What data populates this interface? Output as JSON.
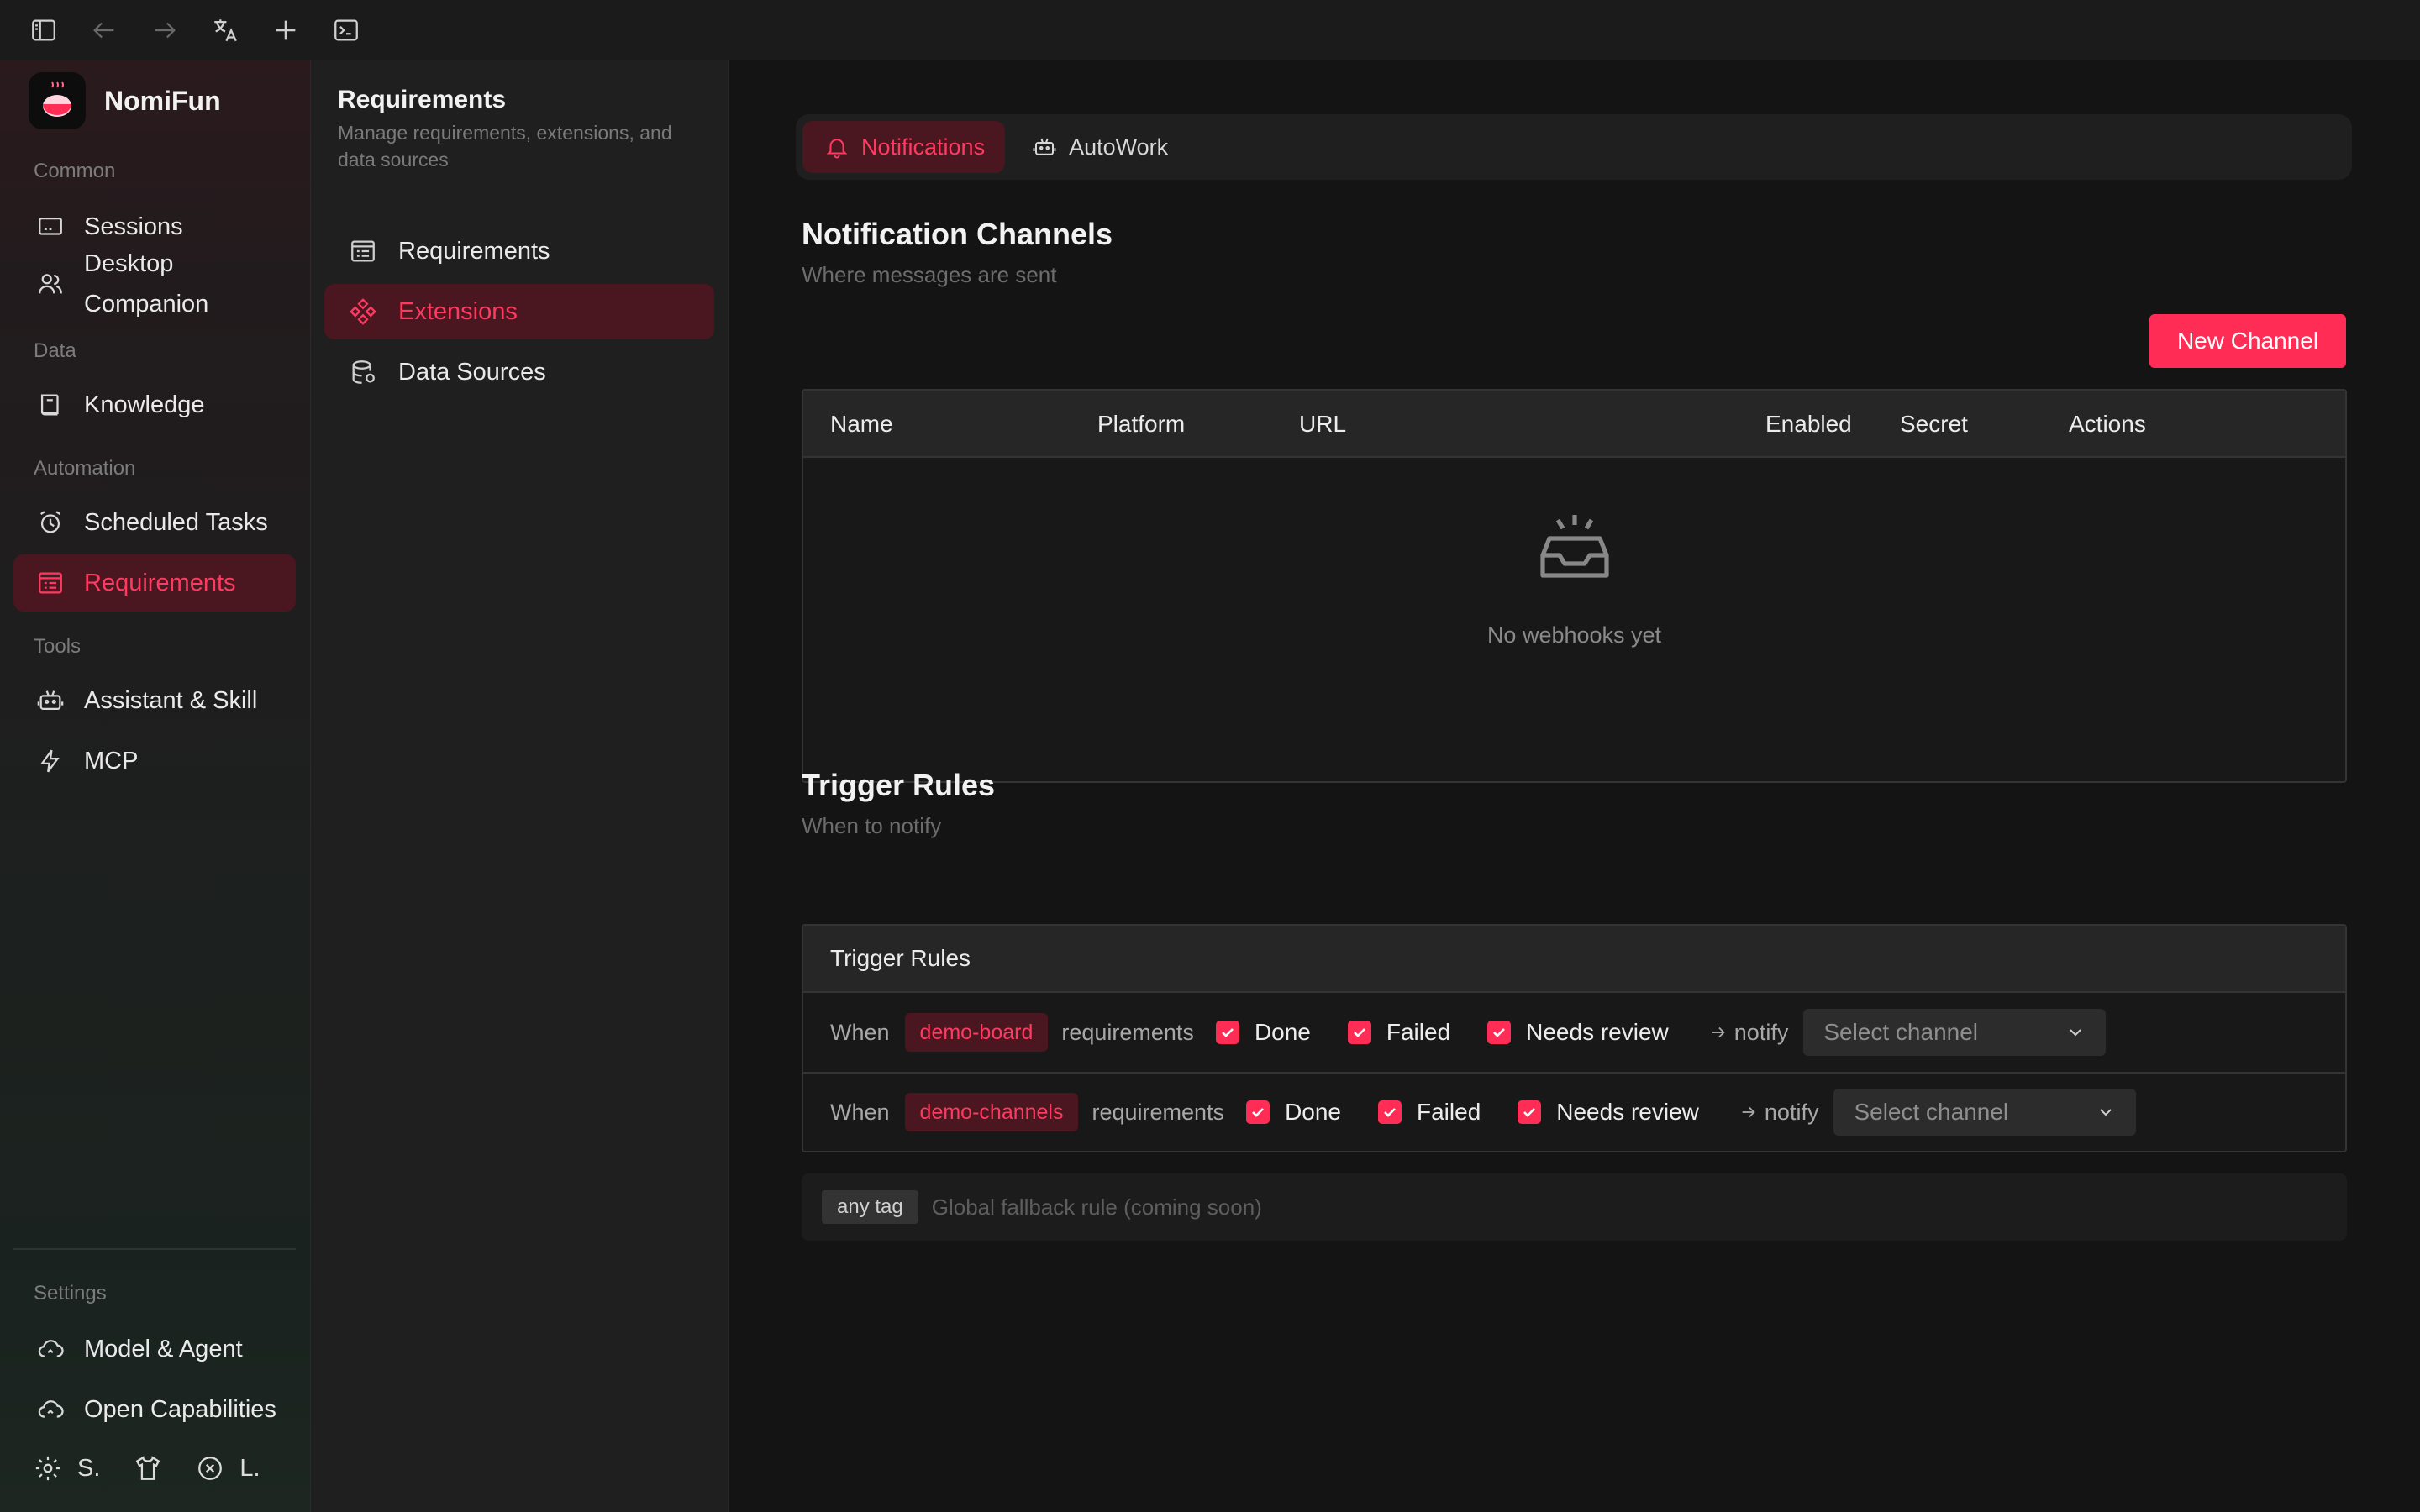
{
  "app": {
    "name": "NomiFun",
    "accent": "#ff2d55"
  },
  "topbar": {
    "icons": [
      "sidebar-toggle-icon",
      "back-arrow-icon",
      "forward-arrow-icon",
      "translate-icon",
      "plus-icon",
      "terminal-icon"
    ]
  },
  "sidebar": {
    "sections": {
      "common": "Common",
      "data": "Data",
      "automation": "Automation",
      "tools": "Tools",
      "settings": "Settings"
    },
    "items": {
      "sessions": "Sessions",
      "desktop_companion": "Desktop Companion",
      "knowledge": "Knowledge",
      "scheduled_tasks": "Scheduled Tasks",
      "requirements": "Requirements",
      "assistant_skill": "Assistant & Skill",
      "mcp": "MCP",
      "model_agent": "Model & Agent",
      "open_capabilities": "Open Capabilities"
    },
    "bottom": {
      "settings_short": "S.",
      "language_short": "L."
    }
  },
  "panel": {
    "title": "Requirements",
    "description": "Manage requirements, extensions, and data sources",
    "items": {
      "requirements": "Requirements",
      "extensions": "Extensions",
      "data_sources": "Data Sources"
    }
  },
  "main": {
    "tabs": {
      "notifications": "Notifications",
      "autowork": "AutoWork"
    },
    "channels": {
      "title": "Notification Channels",
      "subtitle": "Where messages are sent",
      "new_button": "New Channel",
      "columns": {
        "name": "Name",
        "platform": "Platform",
        "url": "URL",
        "enabled": "Enabled",
        "secret": "Secret",
        "actions": "Actions"
      },
      "empty_text": "No webhooks yet"
    },
    "triggers": {
      "title": "Trigger Rules",
      "subtitle": "When to notify",
      "table_header": "Trigger Rules",
      "rows": [
        {
          "when": "When",
          "tag": "demo-board",
          "requirements": "requirements",
          "done": "Done",
          "failed": "Failed",
          "needs_review": "Needs review",
          "notify": "notify",
          "select_placeholder": "Select channel"
        },
        {
          "when": "When",
          "tag": "demo-channels",
          "requirements": "requirements",
          "done": "Done",
          "failed": "Failed",
          "needs_review": "Needs review",
          "notify": "notify",
          "select_placeholder": "Select channel"
        }
      ],
      "fallback_tag": "any tag",
      "fallback_text": "Global fallback rule (coming soon)"
    }
  }
}
